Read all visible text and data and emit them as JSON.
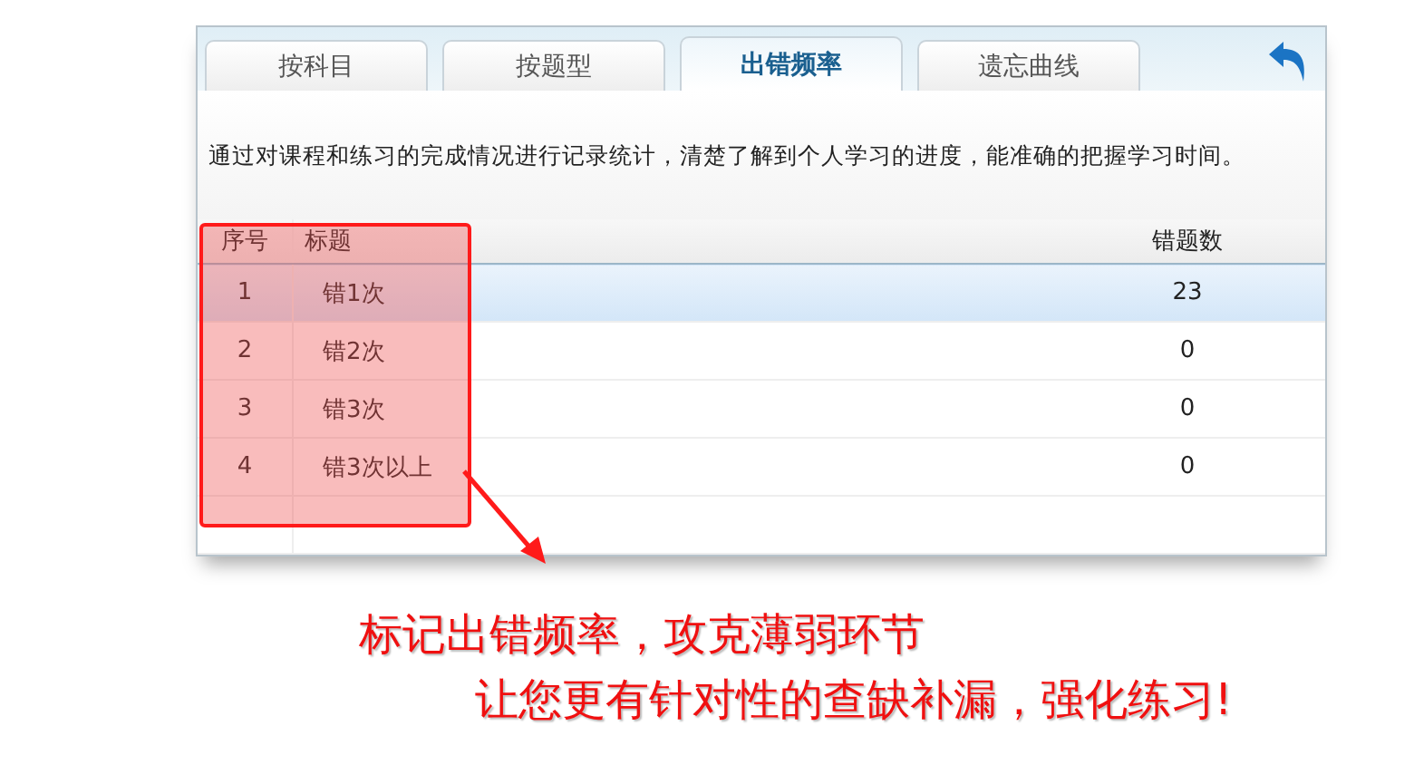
{
  "tabs": [
    {
      "label": "按科目",
      "selected": false
    },
    {
      "label": "按题型",
      "selected": false
    },
    {
      "label": "出错频率",
      "selected": true
    },
    {
      "label": "遗忘曲线",
      "selected": false
    }
  ],
  "description": "通过对课程和练习的完成情况进行记录统计，清楚了解到个人学习的进度，能准确的把握学习时间。",
  "table": {
    "columns": [
      "序号",
      "标题",
      "错题数"
    ],
    "rows": [
      {
        "cells": [
          "1",
          "错1次",
          "23"
        ],
        "selected": true
      },
      {
        "cells": [
          "2",
          "错2次",
          "0"
        ],
        "selected": false
      },
      {
        "cells": [
          "3",
          "错3次",
          "0"
        ],
        "selected": false
      },
      {
        "cells": [
          "4",
          "错3次以上",
          "0"
        ],
        "selected": false
      }
    ]
  },
  "captions": [
    "标记出错频率，攻克薄弱环节",
    "让您更有针对性的查缺补漏，强化练习!"
  ]
}
